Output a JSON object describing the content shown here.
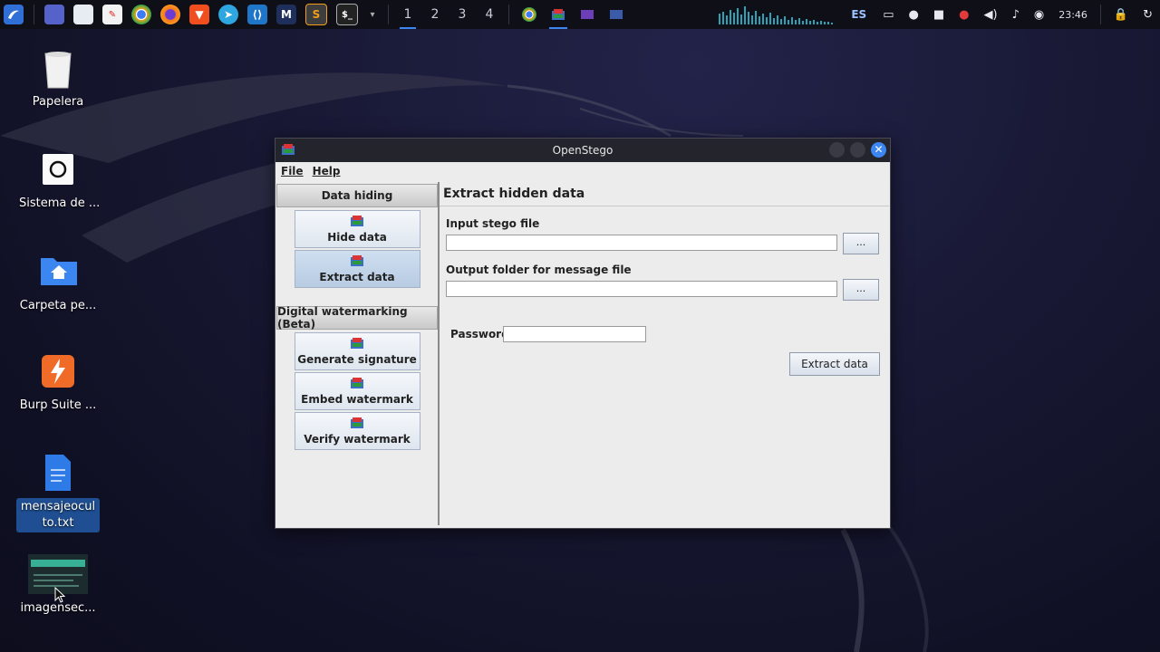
{
  "taskbar": {
    "workspaces": [
      "1",
      "2",
      "3",
      "4"
    ],
    "active_workspace": "1",
    "tray": {
      "language": "ES",
      "clock": "23:46"
    },
    "app_icons": [
      "kali-menu-icon",
      "desktop-icon",
      "folder-icon",
      "pdf-icon",
      "chrome-icon",
      "firefox-icon",
      "brave-icon",
      "telegram-icon",
      "vscode-icon",
      "maltego-icon",
      "sublime-icon",
      "terminal-icon"
    ]
  },
  "desktop": {
    "icons": [
      {
        "label": "Papelera",
        "icon": "trash-icon"
      },
      {
        "label": "Sistema de ...",
        "icon": "system-icon"
      },
      {
        "label": "Carpeta pe...",
        "icon": "home-folder-icon"
      },
      {
        "label": "Burp Suite ...",
        "icon": "burp-icon"
      },
      {
        "label": "mensajeoculto.txt",
        "icon": "text-file-icon",
        "selected": true
      },
      {
        "label": "imagensec...",
        "icon": "image-file-icon"
      }
    ]
  },
  "window": {
    "title": "OpenStego",
    "menu": [
      "File",
      "Help"
    ],
    "groups": [
      {
        "label": "Data hiding",
        "items": [
          {
            "label": "Hide data",
            "active": false
          },
          {
            "label": "Extract data",
            "active": true
          }
        ]
      },
      {
        "label": "Digital watermarking (Beta)",
        "items": [
          {
            "label": "Generate signature",
            "active": false
          },
          {
            "label": "Embed watermark",
            "active": false
          },
          {
            "label": "Verify watermark",
            "active": false
          }
        ]
      }
    ],
    "panel": {
      "title": "Extract hidden data",
      "input_label": "Input stego file",
      "input_value": "",
      "output_label": "Output folder for message file",
      "output_value": "",
      "browse_label": "...",
      "password_label": "Password",
      "password_value": "",
      "extract_button": "Extract data"
    }
  },
  "colors": {
    "accent": "#3b86f0",
    "selection": "#1f4f92",
    "titlebar": "#24242c"
  }
}
